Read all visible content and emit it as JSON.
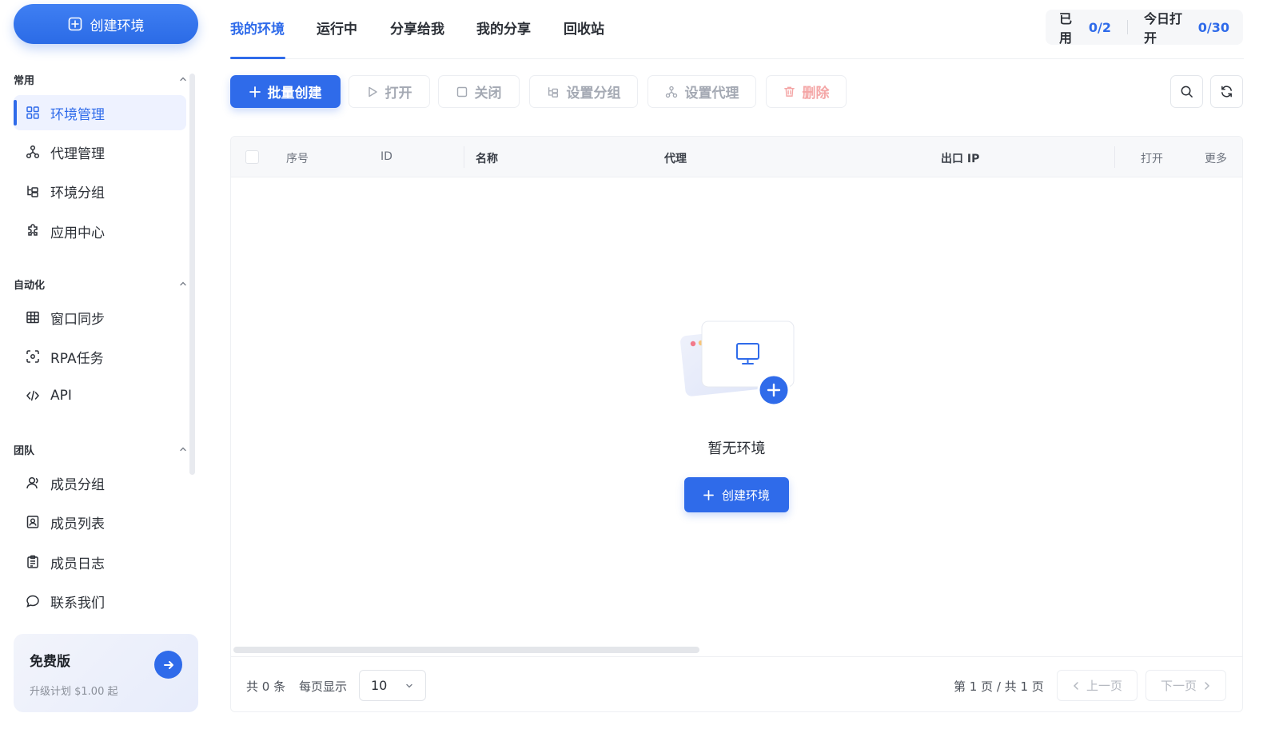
{
  "sidebar": {
    "create_button": "创建环境",
    "sections": [
      {
        "title": "常用",
        "items": [
          "环境管理",
          "代理管理",
          "环境分组",
          "应用中心"
        ]
      },
      {
        "title": "自动化",
        "items": [
          "窗口同步",
          "RPA任务",
          "API"
        ]
      },
      {
        "title": "团队",
        "items": [
          "成员分组",
          "成员列表",
          "成员日志",
          "联系我们"
        ]
      }
    ],
    "active_item": "环境管理",
    "plan": {
      "title": "免费版",
      "subtitle": "升级计划 $1.00 起"
    }
  },
  "tabs": [
    "我的环境",
    "运行中",
    "分享给我",
    "我的分享",
    "回收站"
  ],
  "active_tab": "我的环境",
  "usage": {
    "used_label": "已用",
    "used_value": "0/2",
    "today_label": "今日打开",
    "today_value": "0/30"
  },
  "toolbar": {
    "batch_create": "批量创建",
    "open": "打开",
    "close": "关闭",
    "set_group": "设置分组",
    "set_proxy": "设置代理",
    "delete": "删除"
  },
  "table": {
    "columns": [
      "序号",
      "ID",
      "名称",
      "代理",
      "出口 IP",
      "打开",
      "更多"
    ],
    "empty_text": "暂无环境",
    "empty_button": "创建环境"
  },
  "pagination": {
    "total": "共 0 条",
    "per_page_label": "每页显示",
    "per_page_value": "10",
    "page_info": "第 1 页 / 共 1 页",
    "prev": "上一页",
    "next": "下一页"
  },
  "colors": {
    "primary": "#2f6bea",
    "danger_light": "#f4a6a6",
    "active_bg": "#eef2ff"
  },
  "icons": {
    "create_button": "plus-square-icon",
    "nav": [
      "grid-icon",
      "proxy-nodes-icon",
      "group-tree-icon",
      "puzzle-icon",
      "window-grid-icon",
      "rpa-scan-icon",
      "code-icon",
      "user-icon",
      "contact-card-icon",
      "clipboard-icon",
      "chat-bubble-icon"
    ],
    "toolbar": [
      "plus-icon",
      "play-icon",
      "square-icon",
      "group-tree-icon",
      "proxy-nodes-icon",
      "trash-icon",
      "search-icon",
      "refresh-icon"
    ]
  }
}
